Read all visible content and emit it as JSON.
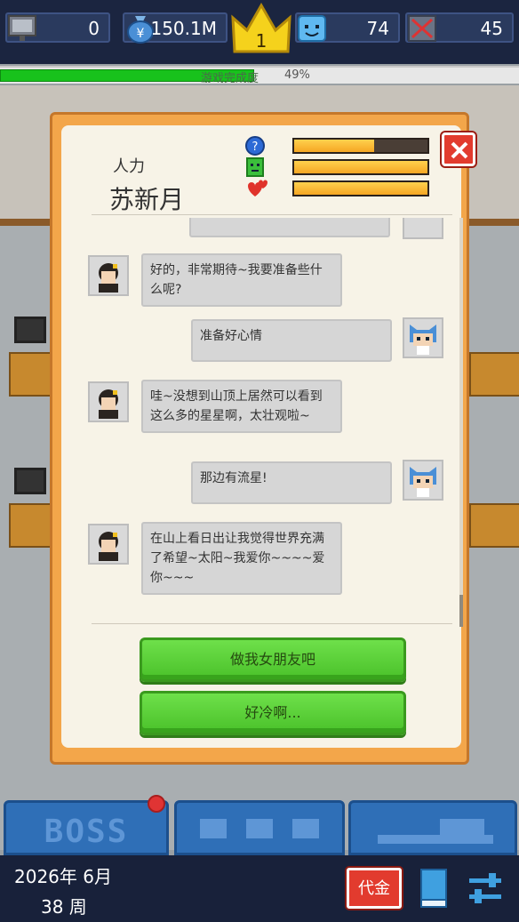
{
  "top_bar": {
    "tv_count": "0",
    "money": "150.1M",
    "level": "1",
    "face_count": "74",
    "box_count": "45"
  },
  "progress": {
    "label": "游戏完成度",
    "percent_text": "49%",
    "value": 0.49
  },
  "dialog": {
    "role": "人力",
    "name": "苏新月",
    "meters": [
      {
        "icon": "question-heart-icon",
        "value": 0.6
      },
      {
        "icon": "green-smile-icon",
        "value": 1.0
      },
      {
        "icon": "red-hearts-icon",
        "value": 1.0
      }
    ],
    "messages": [
      {
        "side": "left",
        "text": "好的，非常期待~我要准备些什么呢?"
      },
      {
        "side": "right",
        "text": "准备好心情"
      },
      {
        "side": "left",
        "text": "哇~没想到山顶上居然可以看到这么多的星星啊，太壮观啦~"
      },
      {
        "side": "right",
        "text": "那边有流星!"
      },
      {
        "side": "left",
        "text": "在山上看日出让我觉得世界充满了希望~太阳~我爱你~~~~爱你~~~"
      }
    ],
    "choices": [
      "做我女朋友吧",
      "好冷啊..."
    ]
  },
  "bottom_tabs": [
    "BOSS",
    "",
    ""
  ],
  "bottom_bar": {
    "date": "2026年 6月",
    "week": "38 周",
    "voucher_label": "代金"
  },
  "colors": {
    "accent_green": "#4ac12a",
    "panel_orange": "#f3a64a",
    "close_red": "#e23b2e",
    "nav_blue": "#2f6fb7"
  }
}
